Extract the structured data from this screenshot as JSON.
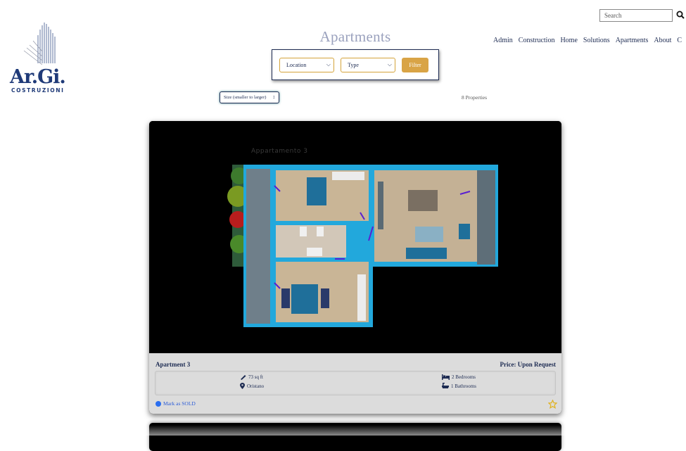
{
  "brand": {
    "name": "Ar.Gi.",
    "tagline": "COSTRUZIONI"
  },
  "header": {
    "search": {
      "placeholder": "Search"
    },
    "nav": [
      "Admin",
      "Construction",
      "Home",
      "Solutions",
      "Apartments",
      "About",
      "C"
    ]
  },
  "page": {
    "title": "Apartments"
  },
  "filters": {
    "location_label": "Location",
    "type_label": "Type",
    "filter_button": "Filter",
    "sort_label": "Size (smaller to larger)",
    "count_text": "8 Properties"
  },
  "listing": {
    "plan_label": "Appartamento 3",
    "title": "Apartment 3",
    "price": "Price: Upon Request",
    "size": "73 sq ft",
    "city": "Oristano",
    "bedrooms": "2 Bedrooms",
    "bathrooms": "1 Bathrooms",
    "mark_sold": "Mark as SOLD"
  },
  "colors": {
    "navy": "#1d2b52",
    "accent_gold": "#d9a446",
    "wall_cyan": "#22a8dc",
    "floor_wood": "#cdb79a",
    "sold_link": "#2a5bd7"
  },
  "icons": [
    "search-icon",
    "ruler-icon",
    "map-pin-icon",
    "bed-icon",
    "bath-icon",
    "star-icon",
    "chevron-down-icon"
  ]
}
